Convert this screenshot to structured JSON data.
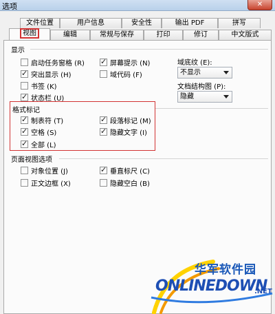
{
  "window": {
    "title": "选项"
  },
  "tabs_row1": [
    "文件位置",
    "用户信息",
    "安全性",
    "输出 PDF",
    "拼写"
  ],
  "tabs_row2": [
    "视图",
    "编辑",
    "常规与保存",
    "打印",
    "修订",
    "中文版式"
  ],
  "display": {
    "title": "显示",
    "checkboxes": [
      {
        "label": "启动任务窗格 (R)",
        "checked": false
      },
      {
        "label": "突出显示 (H)",
        "checked": true
      },
      {
        "label": "书签 (K)",
        "checked": false
      },
      {
        "label": "状态栏 (U)",
        "checked": true
      },
      {
        "label": "屏幕提示 (N)",
        "checked": true
      },
      {
        "label": "域代码 (F)",
        "checked": false
      }
    ],
    "field_shading_label": "域底纹 (E):",
    "field_shading_value": "不显示",
    "doc_map_label": "文档结构图 (P):",
    "doc_map_value": "隐藏"
  },
  "format_marks": {
    "title": "格式标记",
    "checkboxes": [
      {
        "label": "制表符 (T)",
        "checked": true
      },
      {
        "label": "空格 (S)",
        "checked": true
      },
      {
        "label": "全部 (L)",
        "checked": true
      },
      {
        "label": "段落标记 (M)",
        "checked": true
      },
      {
        "label": "隐藏文字 (I)",
        "checked": true
      }
    ]
  },
  "page_view": {
    "title": "页面视图选项",
    "checkboxes": [
      {
        "label": "对象位置 (J)",
        "checked": false
      },
      {
        "label": "正文边框 (X)",
        "checked": false
      },
      {
        "label": "垂直标尺 (C)",
        "checked": true
      },
      {
        "label": "隐藏空白 (B)",
        "checked": false
      }
    ]
  },
  "watermark": {
    "cn": "华军软件园",
    "en": "ONLINEDOWN",
    "net": ".NET"
  },
  "colors": {
    "highlight": "#d23232",
    "accent": "#1e4fb4"
  }
}
